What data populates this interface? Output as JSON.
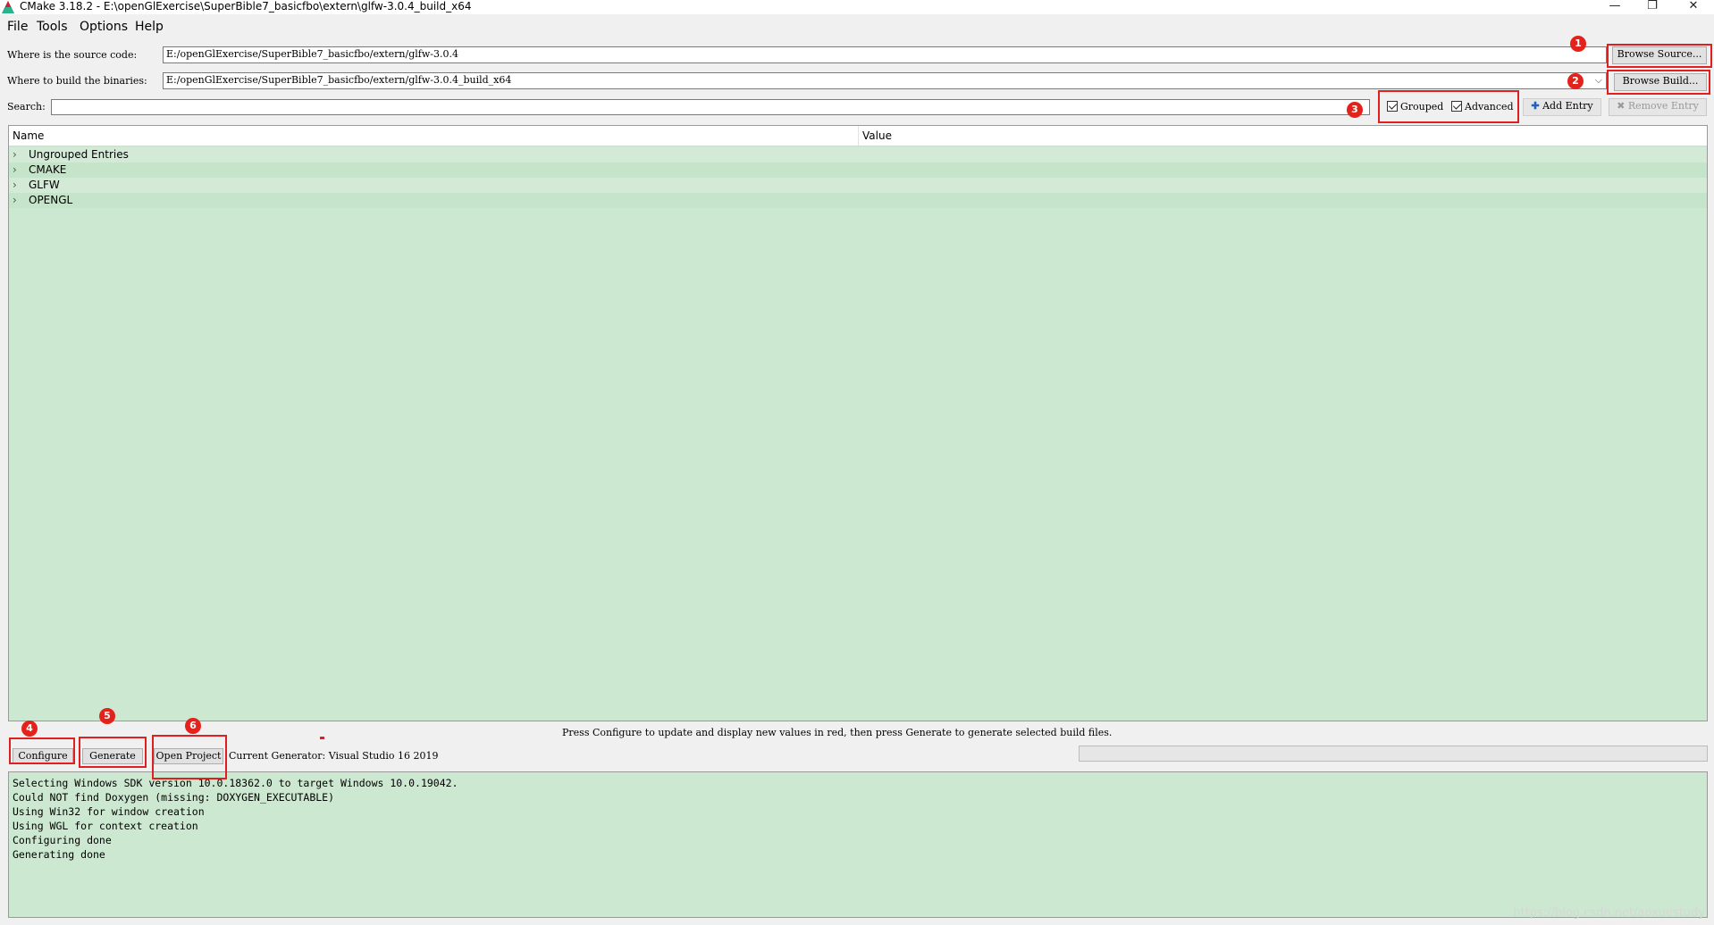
{
  "window": {
    "title": "CMake 3.18.2 - E:\\openGlExercise\\SuperBible7_basicfbo\\extern\\glfw-3.0.4_build_x64",
    "minimize": "—",
    "restore": "❐",
    "close": "✕"
  },
  "menu": [
    "File",
    "Tools",
    "Options",
    "Help"
  ],
  "source": {
    "label": "Where is the source code:",
    "value": "E:/openGlExercise/SuperBible7_basicfbo/extern/glfw-3.0.4",
    "button": "Browse Source..."
  },
  "build": {
    "label": "Where to build the binaries:",
    "value": "E:/openGlExercise/SuperBible7_basicfbo/extern/glfw-3.0.4_build_x64",
    "button": "Browse Build..."
  },
  "search": {
    "label": "Search:",
    "value": "",
    "grouped_label": "Grouped",
    "grouped_checked": true,
    "advanced_label": "Advanced",
    "advanced_checked": true,
    "add_entry": "Add Entry",
    "remove_entry": "Remove Entry"
  },
  "table": {
    "columns": [
      "Name",
      "Value"
    ],
    "groups": [
      "Ungrouped Entries",
      "CMAKE",
      "GLFW",
      "OPENGL"
    ]
  },
  "status_hint": "Press Configure to update and display new values in red, then press Generate to generate selected build files.",
  "actions": {
    "configure": "Configure",
    "generate": "Generate",
    "open_project": "Open Project",
    "generator": "Current Generator: Visual Studio 16 2019"
  },
  "output_lines": [
    "Selecting Windows SDK version 10.0.18362.0 to target Windows 10.0.19042.",
    "Could NOT find Doxygen (missing: DOXYGEN_EXECUTABLE)",
    "Using Win32 for window creation",
    "Using WGL for context creation",
    "Configuring done",
    "Generating done"
  ],
  "annotations": [
    "1",
    "2",
    "3",
    "4",
    "5",
    "6"
  ],
  "watermark": "https://blog.csdn.net/aoxuestudy",
  "colors": {
    "panel_green": "#cde8d0",
    "annotation_red": "#e3231b"
  }
}
